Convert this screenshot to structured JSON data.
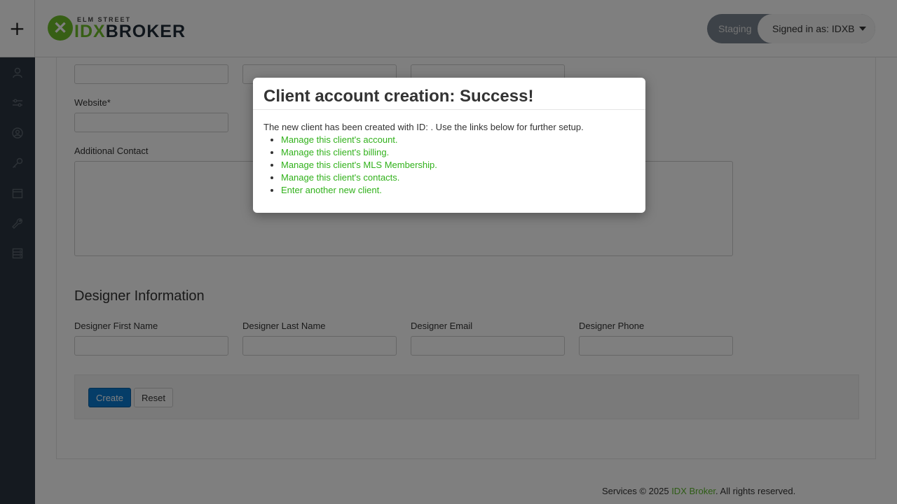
{
  "sidebar": {
    "add_glyph": "+",
    "icons": [
      "user-icon",
      "sliders-icon",
      "account-circle-icon",
      "key-icon",
      "calendar-icon",
      "wrench-icon",
      "server-icon"
    ]
  },
  "header": {
    "logo_small": "ELM STREET",
    "logo_idx": "IDX",
    "logo_broker": "BROKER",
    "env_label": "Staging",
    "signed_in": "Signed in as: IDXB"
  },
  "form": {
    "website_label": "Website*",
    "additional_contact_label": "Additional Contact",
    "designer_section_title": "Designer Information",
    "designer_first_name_label": "Designer First Name",
    "designer_last_name_label": "Designer Last Name",
    "designer_email_label": "Designer Email",
    "designer_phone_label": "Designer Phone",
    "create_button": "Create",
    "reset_button": "Reset"
  },
  "footer": {
    "prefix": "Services © 2025 ",
    "link": "IDX Broker",
    "suffix": ". All rights reserved."
  },
  "modal": {
    "title": "Client account creation: Success!",
    "message": "The new client has been created with ID: . Use the links below for further setup.",
    "links": [
      "Manage this client's account.",
      "Manage this client's billing.",
      "Manage this client's MLS Membership.",
      "Manage this client's contacts.",
      "Enter another new client."
    ]
  },
  "colors": {
    "brand_green": "#6fbf2b",
    "link_green": "#31b11b",
    "sidebar": "#2b3540",
    "primary": "#0b7ad1"
  }
}
